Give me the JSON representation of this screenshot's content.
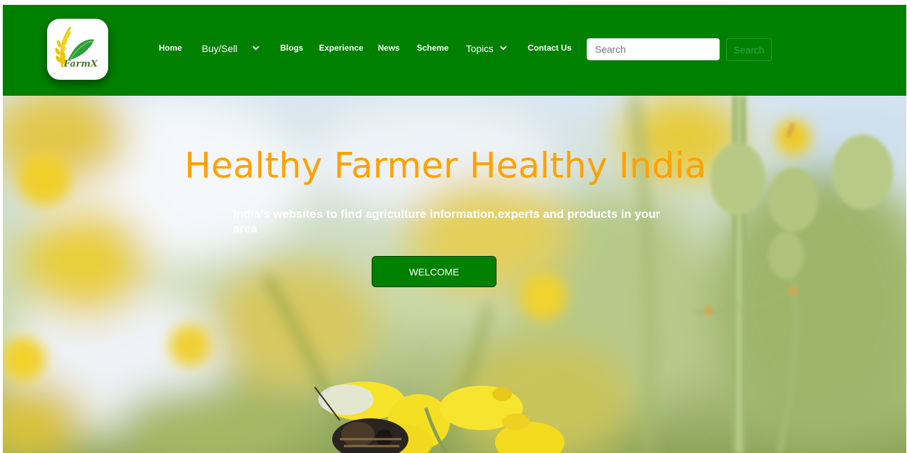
{
  "brand": {
    "logo_text": "FarmX"
  },
  "nav": {
    "home": "Home",
    "buy_sell": "Buy/Sell",
    "blogs": "Blogs",
    "experience": "Experience",
    "news": "News",
    "scheme": "Scheme",
    "topics": "Topics",
    "contact": "Contact Us"
  },
  "search": {
    "placeholder": "Search",
    "button_label": "Search"
  },
  "hero": {
    "title": "Healthy Farmer Healthy India",
    "subtitle": "India's websites to find agriculture information,experts and products in your area",
    "button_label": "WELCOME"
  },
  "colors": {
    "navbar": "#008000",
    "title": "#ffa100",
    "button": "#008000"
  },
  "icons": {
    "logo": "wheat-leaf-icon",
    "dropdown": "chevron-down-icon"
  }
}
